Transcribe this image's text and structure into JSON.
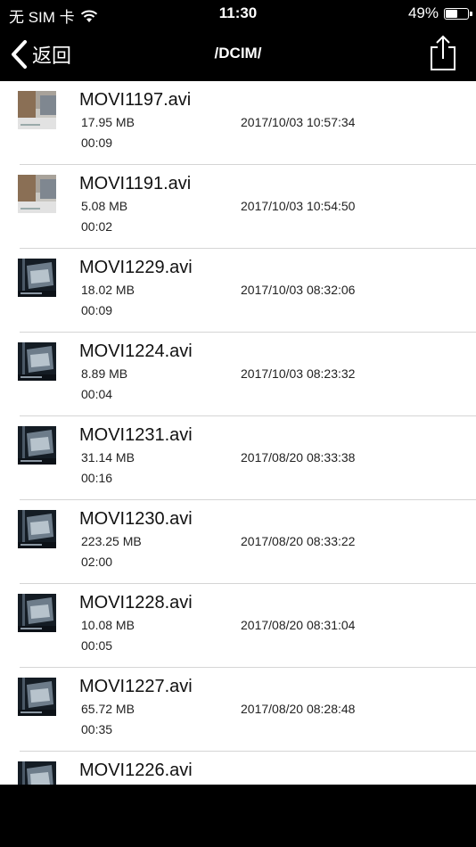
{
  "status_bar": {
    "carrier": "无 SIM 卡",
    "time": "11:30",
    "battery": "49%",
    "battery_level": 0.49,
    "icons": [
      "wifi-icon",
      "battery-icon"
    ]
  },
  "nav": {
    "back_label": "返回",
    "title": "/DCIM/",
    "icons": [
      "chevron-left-icon",
      "share-icon"
    ]
  },
  "files": [
    {
      "name": "MOVI1197.avi",
      "size": "17.95 MB",
      "date": "2017/10/03 10:57:34",
      "duration": "00:09",
      "thumb": "indoor-bright"
    },
    {
      "name": "MOVI1191.avi",
      "size": "5.08 MB",
      "date": "2017/10/03 10:54:50",
      "duration": "00:02",
      "thumb": "indoor-bright"
    },
    {
      "name": "MOVI1229.avi",
      "size": "18.02 MB",
      "date": "2017/10/03 08:32:06",
      "duration": "00:09",
      "thumb": "night-garage"
    },
    {
      "name": "MOVI1224.avi",
      "size": "8.89 MB",
      "date": "2017/10/03 08:23:32",
      "duration": "00:04",
      "thumb": "night-garage"
    },
    {
      "name": "MOVI1231.avi",
      "size": "31.14 MB",
      "date": "2017/08/20 08:33:38",
      "duration": "00:16",
      "thumb": "night-garage"
    },
    {
      "name": "MOVI1230.avi",
      "size": "223.25 MB",
      "date": "2017/08/20 08:33:22",
      "duration": "02:00",
      "thumb": "night-garage"
    },
    {
      "name": "MOVI1228.avi",
      "size": "10.08 MB",
      "date": "2017/08/20 08:31:04",
      "duration": "00:05",
      "thumb": "night-garage"
    },
    {
      "name": "MOVI1227.avi",
      "size": "65.72 MB",
      "date": "2017/08/20 08:28:48",
      "duration": "00:35",
      "thumb": "night-garage"
    },
    {
      "name": "MOVI1226.avi",
      "size": "",
      "date": "",
      "duration": "",
      "thumb": "night-garage"
    }
  ],
  "colors": {
    "bar_background": "#000000",
    "list_background": "#ffffff",
    "divider": "#d5d5d5"
  }
}
